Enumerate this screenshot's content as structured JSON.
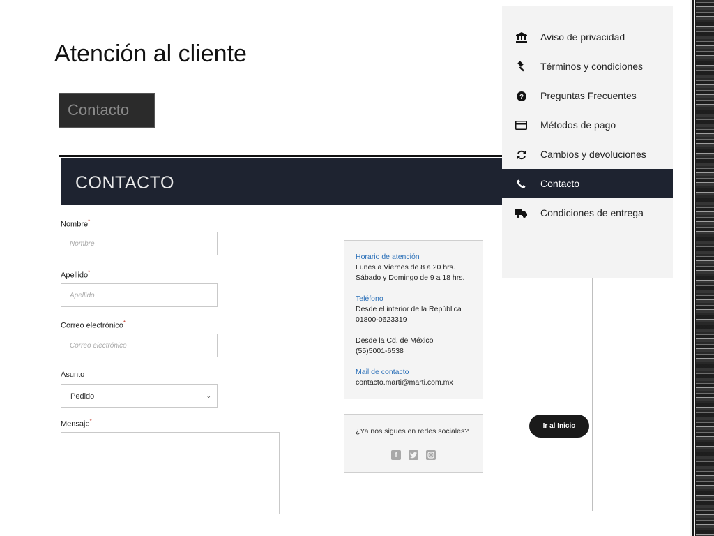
{
  "slide": {
    "title": "Atención al cliente"
  },
  "badge": {
    "label": "Contacto"
  },
  "form": {
    "header": "CONTACTO",
    "required_mark": "*",
    "nombre": {
      "label": "Nombre",
      "placeholder": "Nombre"
    },
    "apellido": {
      "label": "Apellido",
      "placeholder": "Apellido"
    },
    "correo": {
      "label": "Correo electrónico",
      "placeholder": "Correo electrónico"
    },
    "asunto": {
      "label": "Asunto",
      "value": "Pedido"
    },
    "mensaje": {
      "label": "Mensaje"
    }
  },
  "info": {
    "horario_title": "Horario de atención",
    "horario_1": "Lunes a Viernes de 8 a 20 hrs.",
    "horario_2": "Sábado y Domingo de 9 a 18 hrs.",
    "telefono_title": "Teléfono",
    "telefono_1": "Desde el interior de la República",
    "telefono_2": "01800-0623319",
    "cdmx_1": "Desde la Cd. de México",
    "cdmx_2": "(55)5001-6538",
    "mail_title": "Mail de contacto",
    "mail": "contacto.marti@marti.com.mx"
  },
  "social": {
    "question": "¿Ya nos sigues en redes sociales?",
    "icons": [
      "facebook-icon",
      "twitter-icon",
      "instagram-icon"
    ]
  },
  "home_button": "Ir al Inicio",
  "menu": {
    "items": [
      {
        "label": "Aviso de privacidad",
        "icon": "bank-icon"
      },
      {
        "label": "Términos y condiciones",
        "icon": "gavel-icon"
      },
      {
        "label": "Preguntas Frecuentes",
        "icon": "question-icon"
      },
      {
        "label": "Métodos de pago",
        "icon": "credit-card-icon"
      },
      {
        "label": "Cambios y devoluciones",
        "icon": "refresh-icon"
      },
      {
        "label": "Contacto",
        "icon": "phone-icon",
        "active": true
      },
      {
        "label": "Condiciones de entrega",
        "icon": "truck-icon"
      }
    ]
  },
  "colors": {
    "dark_header": "#1e2330",
    "link_blue": "#2a6fb8",
    "required_red": "#c0392b"
  }
}
